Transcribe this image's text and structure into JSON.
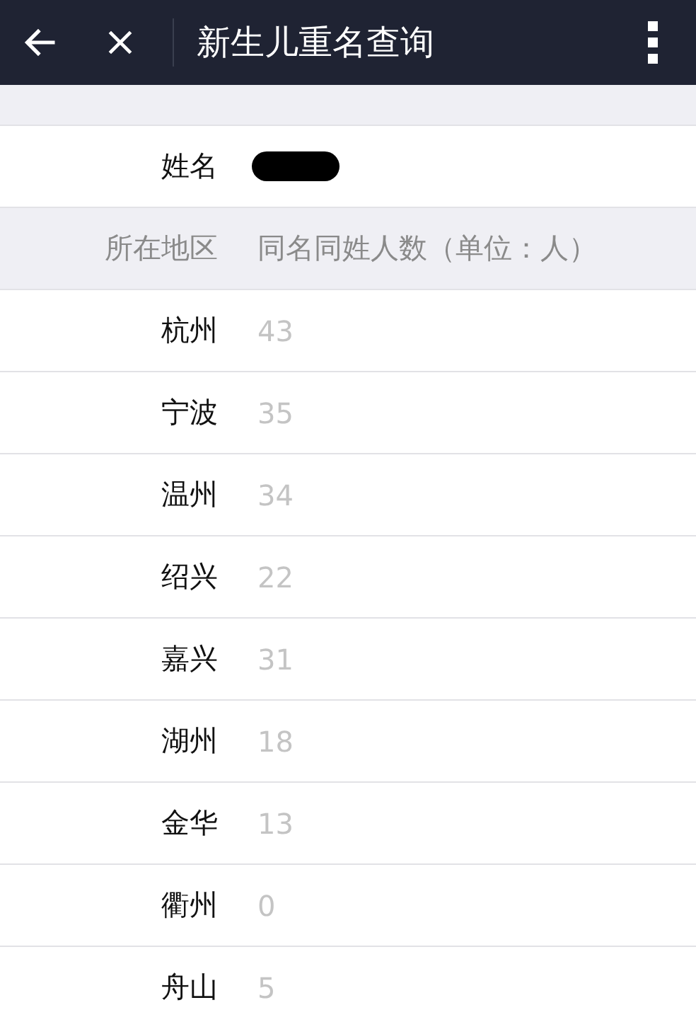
{
  "top_bar": {
    "title": "新生儿重名查询"
  },
  "name_row": {
    "label": "姓名",
    "redacted": true
  },
  "table": {
    "columns": [
      "所在地区",
      "同名同姓人数（单位：人）"
    ],
    "rows": [
      {
        "region": "杭州",
        "count": "43"
      },
      {
        "region": "宁波",
        "count": "35"
      },
      {
        "region": "温州",
        "count": "34"
      },
      {
        "region": "绍兴",
        "count": "22"
      },
      {
        "region": "嘉兴",
        "count": "31"
      },
      {
        "region": "湖州",
        "count": "18"
      },
      {
        "region": "金华",
        "count": "13"
      },
      {
        "region": "衢州",
        "count": "0"
      },
      {
        "region": "舟山",
        "count": "5"
      }
    ]
  }
}
